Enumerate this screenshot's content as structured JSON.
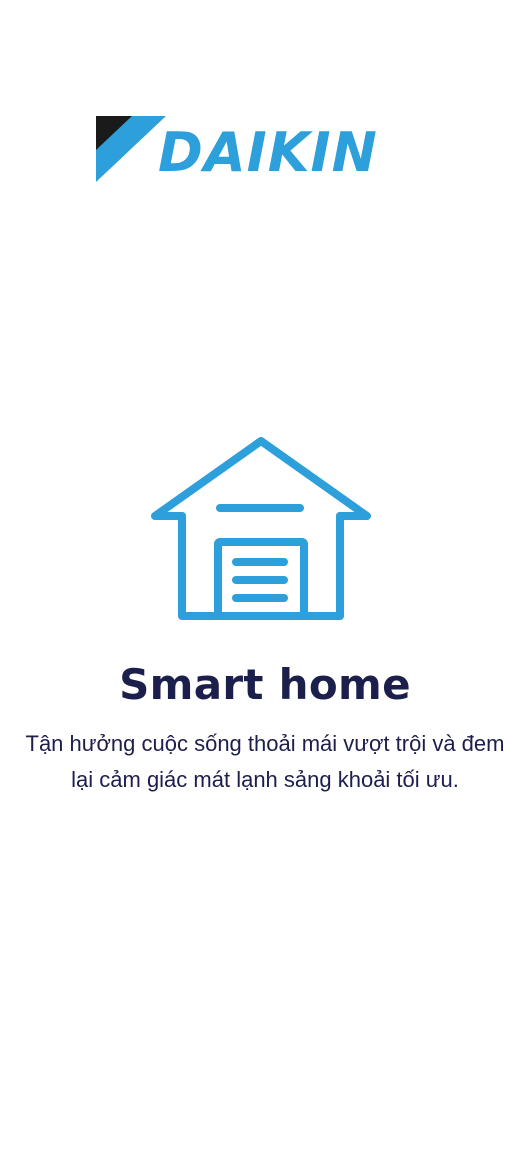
{
  "brand": {
    "logo_text": "DAIKIN",
    "logo_icon": "daikin-logo-icon",
    "primary_color": "#2d9fdb",
    "dark_color": "#1c1f4c"
  },
  "feature": {
    "icon": "house-garage-icon",
    "title": "Smart home",
    "description": "Tận hưởng cuộc sống thoải mái vượt trội và đem lại cảm giác mát lạnh sảng khoải tối ưu."
  }
}
